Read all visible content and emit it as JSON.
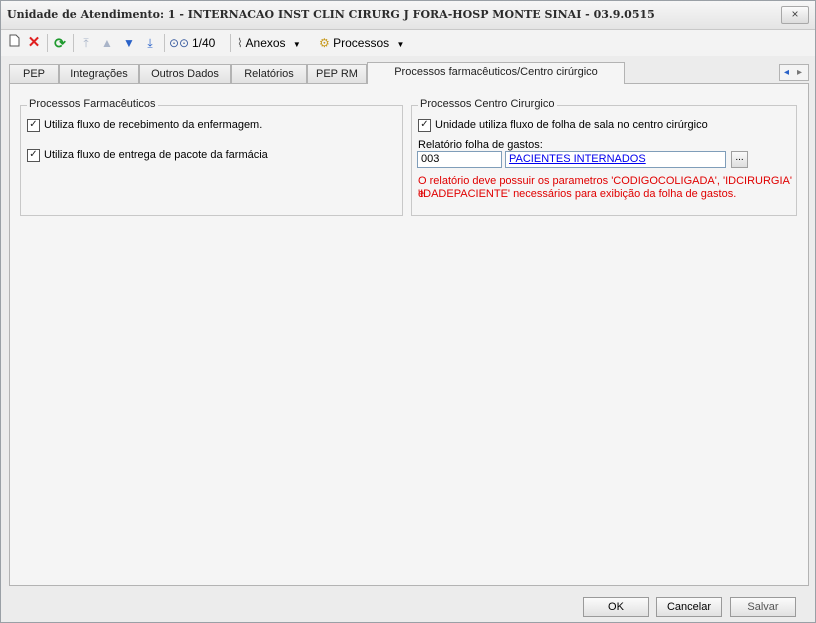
{
  "window": {
    "title": "Unidade de Atendimento: 1 - INTERNACAO INST CLIN CIRURG J FORA-HOSP MONTE SINAI - 03.9.0515",
    "close": "×"
  },
  "toolbar": {
    "record_counter": "1/40",
    "anexos_label": "Anexos",
    "processos_label": "Processos"
  },
  "tabs": [
    {
      "label": "PEP"
    },
    {
      "label": "Integrações"
    },
    {
      "label": "Outros Dados"
    },
    {
      "label": "Relatórios"
    },
    {
      "label": "PEP RM"
    },
    {
      "label": "Processos farmacêuticos/Centro cirúrgico"
    }
  ],
  "farmaceuticos": {
    "title": "Processos Farmacêuticos",
    "options": [
      {
        "label": "Utiliza fluxo de recebimento da enfermagem.",
        "checked": true
      },
      {
        "label": "Utiliza fluxo de entrega de pacote da farmácia",
        "checked": true
      }
    ]
  },
  "centro": {
    "title": "Processos Centro Cirurgico",
    "option": {
      "label": "Unidade utiliza fluxo de folha de sala no centro cirúrgico",
      "checked": true
    },
    "report_label": "Relatório folha de gastos:",
    "report_code": "003",
    "report_name": "PACIENTES INTERNADOS",
    "browse": "...",
    "warning_line1": "O relatório deve possuir os parametros 'CODIGOCOLIGADA', 'IDCIRURGIA' e",
    "warning_line2": "'IDADEPACIENTE' necessários para exibição da folha de gastos."
  },
  "footer": {
    "ok": "OK",
    "cancel": "Cancelar",
    "save": "Salvar"
  }
}
